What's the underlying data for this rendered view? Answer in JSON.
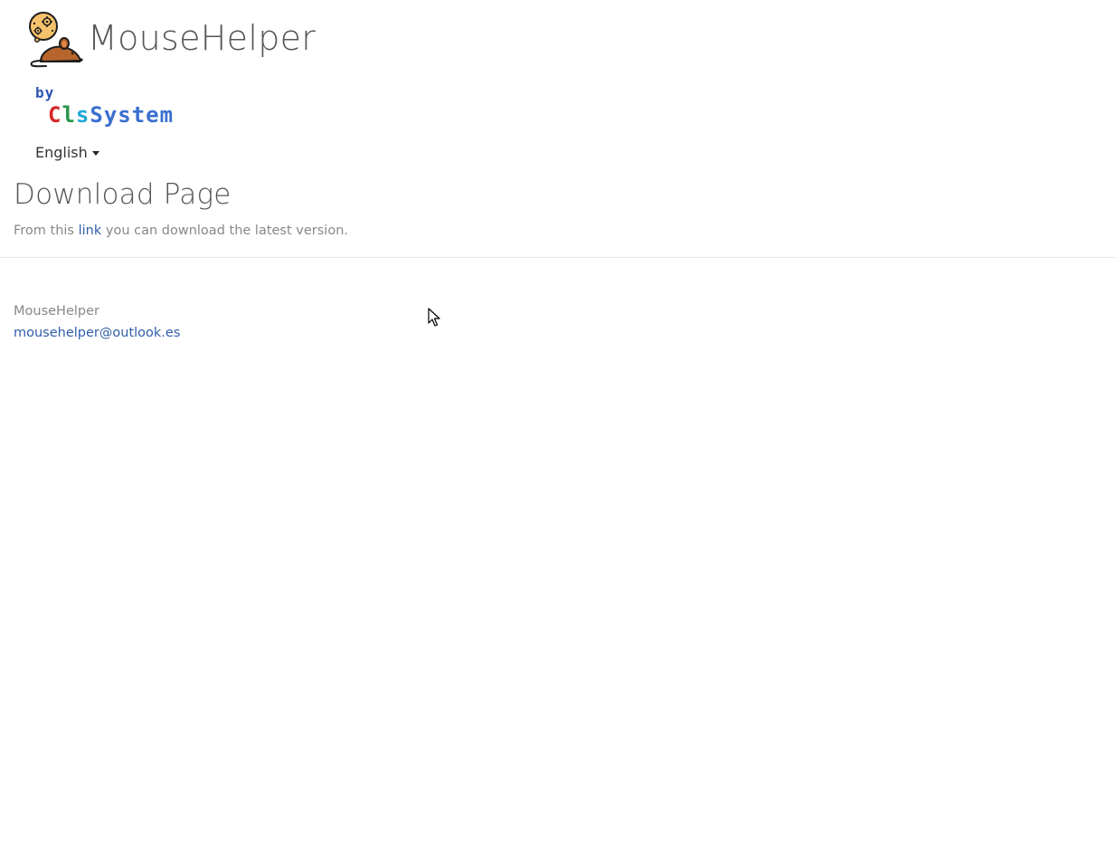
{
  "brand": {
    "title": "MouseHelper",
    "logo_icon": "mouse-gear-thought-icon",
    "by_label": "by",
    "company_letters": [
      {
        "char": "C",
        "color": "#d8282a"
      },
      {
        "char": "l",
        "color": "#27964a"
      },
      {
        "char": "s",
        "color": "#1fa7d6"
      },
      {
        "char": "S",
        "color": "#3a6fd0"
      },
      {
        "char": "y",
        "color": "#3a6fd0"
      },
      {
        "char": "s",
        "color": "#3a6fd0"
      },
      {
        "char": "t",
        "color": "#3a6fd0"
      },
      {
        "char": "e",
        "color": "#3a6fd0"
      },
      {
        "char": "m",
        "color": "#3a6fd0"
      }
    ]
  },
  "language": {
    "selected": "English",
    "icon": "caret-down-icon"
  },
  "main": {
    "title": "Download Page",
    "intro_before": "From this ",
    "intro_link": "link",
    "intro_after": " you can download the latest version."
  },
  "footer": {
    "name": "MouseHelper",
    "email": "mousehelper@outlook.es"
  },
  "colors": {
    "link": "#2f5ea8",
    "muted_text": "#888888",
    "heading": "#555555"
  }
}
